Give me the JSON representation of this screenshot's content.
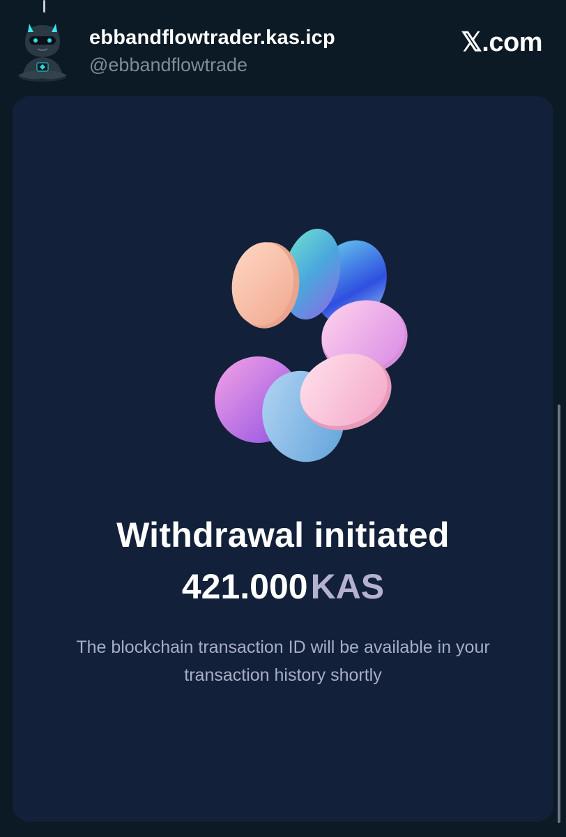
{
  "header": {
    "display_name": "ebbandflowtrader.kas.icp",
    "handle": "@ebbandflowtrade",
    "brand": "𝕏.com"
  },
  "icons": {
    "avatar": "avatar-meditating-character",
    "illustration": "coin-stack-illustration"
  },
  "card": {
    "title": "Withdrawal initiated",
    "amount_value": "421.000",
    "amount_unit": "KAS",
    "subtitle": "The blockchain transaction ID will be available in your transaction history shortly"
  },
  "colors": {
    "background": "#0c1a25",
    "card": "#122039",
    "unit_text": "#b4b0cf",
    "subtitle_text": "#a7aec4",
    "handle_text": "#7f8c97"
  }
}
